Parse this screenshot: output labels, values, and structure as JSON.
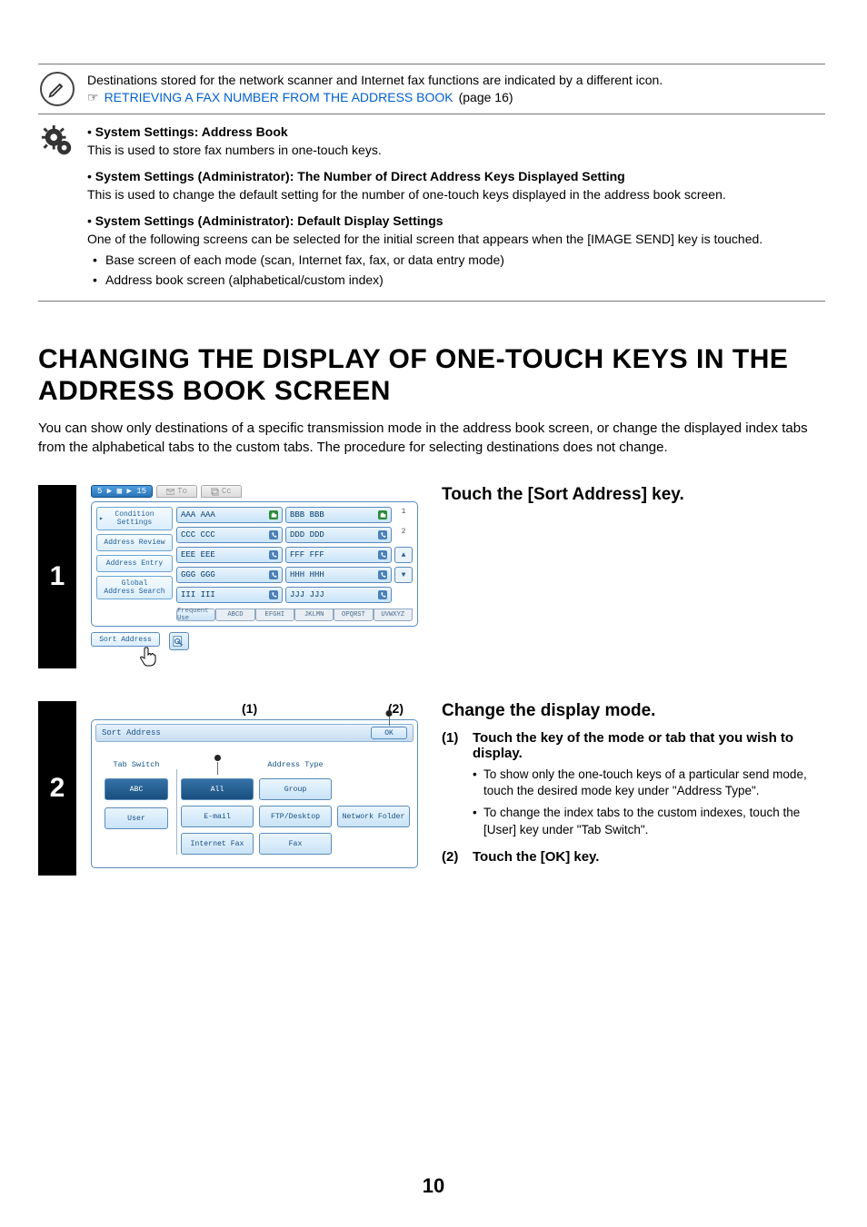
{
  "note": {
    "line1": "Destinations stored for the network scanner and Internet fax functions are indicated by a different icon.",
    "pointer_glyph": "☞",
    "link_text": "RETRIEVING A FAX NUMBER FROM THE ADDRESS BOOK",
    "page_ref": "(page 16)"
  },
  "settings_block": {
    "items": [
      {
        "head": "System Settings: Address Book",
        "desc": "This is used to store fax numbers in one-touch keys."
      },
      {
        "head": "System Settings (Administrator): The Number of Direct Address Keys Displayed Setting",
        "desc": "This is used to change the default setting for the number of one-touch keys displayed in the address book screen."
      },
      {
        "head": "System Settings (Administrator): Default Display Settings",
        "desc": "One of the following screens can be selected for the initial screen that appears when the [IMAGE SEND] key is touched.",
        "subs": [
          "Base screen of each mode (scan, Internet fax, fax, or data entry mode)",
          "Address book screen (alphabetical/custom index)"
        ]
      }
    ]
  },
  "heading": "CHANGING THE DISPLAY OF ONE-TOUCH KEYS IN THE ADDRESS BOOK SCREEN",
  "intro": "You can show only destinations of a specific transmission mode in the address book screen, or change the displayed index tabs from the alphabetical tabs to the custom tabs. The procedure for selecting destinations does not change.",
  "step1": {
    "num": "1",
    "instr_head": "Touch the [Sort Address] key.",
    "screen": {
      "top_blue": "5 ▶ ▦ ▶ 15",
      "tab_to": "To",
      "tab_cc": "Cc",
      "left_buttons": {
        "condition": "Condition\nSettings",
        "review": "Address Review",
        "entry": "Address Entry",
        "global": "Global\nAddress Search",
        "sort": "Sort Address"
      },
      "destinations": [
        {
          "l": "AAA AAA",
          "i": "fax"
        },
        {
          "l": "BBB BBB",
          "i": "fax"
        },
        {
          "l": "CCC CCC",
          "i": "phone"
        },
        {
          "l": "DDD DDD",
          "i": "phone"
        },
        {
          "l": "EEE EEE",
          "i": "phone"
        },
        {
          "l": "FFF FFF",
          "i": "phone"
        },
        {
          "l": "GGG GGG",
          "i": "phone"
        },
        {
          "l": "HHH HHH",
          "i": "phone"
        },
        {
          "l": "III III",
          "i": "phone"
        },
        {
          "l": "JJJ JJJ",
          "i": "phone"
        }
      ],
      "side_nums": [
        "1",
        "2"
      ],
      "tabs": [
        "Frequent Use",
        "ABCD",
        "EFGHI",
        "JKLMN",
        "OPQRST",
        "UVWXYZ"
      ]
    }
  },
  "step2": {
    "num": "2",
    "callouts": [
      "(1)",
      "(2)"
    ],
    "instr_head": "Change the display mode.",
    "substeps": [
      {
        "title": "Touch the key of the mode or tab that you wish to display.",
        "details": [
          "To show only the one-touch keys of a particular send mode, touch the desired mode key under \"Address Type\".",
          "To change the index tabs to the custom indexes, touch the [User] key under \"Tab Switch\"."
        ]
      },
      {
        "title": "Touch the [OK] key.",
        "details": []
      }
    ],
    "screen": {
      "title": "Sort Address",
      "ok": "OK",
      "col1_label": "Tab Switch",
      "col2_label": "Address Type",
      "col1_buttons": [
        "ABC",
        "User"
      ],
      "col2_buttons": [
        "All",
        "Group",
        "E-mail",
        "FTP/Desktop",
        "Network Folder",
        "Internet Fax",
        "Fax"
      ]
    }
  },
  "page_number": "10"
}
